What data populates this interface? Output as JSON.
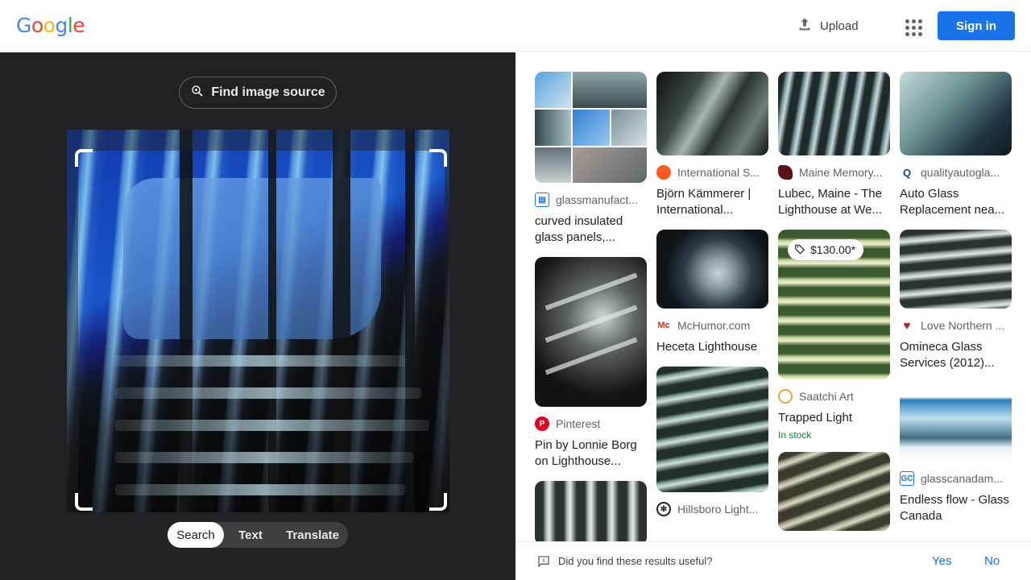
{
  "header": {
    "logo": [
      "G",
      "o",
      "o",
      "g",
      "l",
      "e"
    ],
    "logo_colors": [
      "#4285F4",
      "#EA4335",
      "#FBBC05",
      "#4285F4",
      "#34A853",
      "#EA4335"
    ],
    "upload_label": "Upload",
    "signin_label": "Sign in",
    "colors": {
      "accent": "#1a73e8"
    }
  },
  "left": {
    "find_source_label": "Find image source",
    "modes": [
      "Search",
      "Text",
      "Translate"
    ],
    "active_mode": "Search"
  },
  "results": {
    "col1": [
      {
        "source": "glassmanufact...",
        "title": "curved insulated glass panels,...",
        "favicon": "glassmanufacturer-icon"
      },
      {
        "source": "Pinterest",
        "title": "Pin by Lonnie Borg on Lighthouse...",
        "favicon": "pinterest-icon"
      }
    ],
    "col2": [
      {
        "source": "International S...",
        "title": "Björn Kämmerer | International...",
        "favicon": "international-icon"
      },
      {
        "source": "McHumor.com",
        "title": "Heceta Lighthouse",
        "favicon": "mchumor-icon"
      },
      {
        "source": "Hillsboro Light...",
        "title": "",
        "favicon": "hillsboro-icon"
      }
    ],
    "col3": [
      {
        "source": "Maine Memory...",
        "title": "Lubec, Maine - The Lighthouse at We...",
        "favicon": "maine-memory-icon"
      },
      {
        "source": "Saatchi Art",
        "title": "Trapped Light",
        "price": "$130.00*",
        "stock": "In stock",
        "favicon": "saatchi-art-icon"
      }
    ],
    "col4": [
      {
        "source": "qualityautogla...",
        "title": "Auto Glass Replacement nea...",
        "favicon": "qualityautoglass-icon"
      },
      {
        "source": "Love Northern ...",
        "title": "Omineca Glass Services (2012)...",
        "favicon": "heart-icon"
      },
      {
        "source": "glasscanadam...",
        "title": "Endless flow - Glass Canada",
        "favicon": "glasscanada-icon"
      }
    ]
  },
  "footer": {
    "question": "Did you find these results useful?",
    "yes_label": "Yes",
    "no_label": "No"
  }
}
